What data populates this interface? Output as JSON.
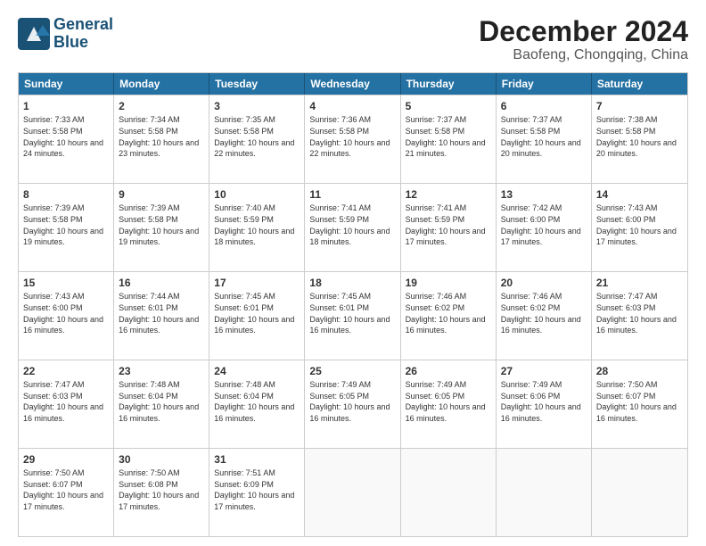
{
  "logo": {
    "line1": "General",
    "line2": "Blue"
  },
  "title": "December 2024",
  "location": "Baofeng, Chongqing, China",
  "header_days": [
    "Sunday",
    "Monday",
    "Tuesday",
    "Wednesday",
    "Thursday",
    "Friday",
    "Saturday"
  ],
  "weeks": [
    [
      {
        "day": "1",
        "sunrise": "Sunrise: 7:33 AM",
        "sunset": "Sunset: 5:58 PM",
        "daylight": "Daylight: 10 hours and 24 minutes."
      },
      {
        "day": "2",
        "sunrise": "Sunrise: 7:34 AM",
        "sunset": "Sunset: 5:58 PM",
        "daylight": "Daylight: 10 hours and 23 minutes."
      },
      {
        "day": "3",
        "sunrise": "Sunrise: 7:35 AM",
        "sunset": "Sunset: 5:58 PM",
        "daylight": "Daylight: 10 hours and 22 minutes."
      },
      {
        "day": "4",
        "sunrise": "Sunrise: 7:36 AM",
        "sunset": "Sunset: 5:58 PM",
        "daylight": "Daylight: 10 hours and 22 minutes."
      },
      {
        "day": "5",
        "sunrise": "Sunrise: 7:37 AM",
        "sunset": "Sunset: 5:58 PM",
        "daylight": "Daylight: 10 hours and 21 minutes."
      },
      {
        "day": "6",
        "sunrise": "Sunrise: 7:37 AM",
        "sunset": "Sunset: 5:58 PM",
        "daylight": "Daylight: 10 hours and 20 minutes."
      },
      {
        "day": "7",
        "sunrise": "Sunrise: 7:38 AM",
        "sunset": "Sunset: 5:58 PM",
        "daylight": "Daylight: 10 hours and 20 minutes."
      }
    ],
    [
      {
        "day": "8",
        "sunrise": "Sunrise: 7:39 AM",
        "sunset": "Sunset: 5:58 PM",
        "daylight": "Daylight: 10 hours and 19 minutes."
      },
      {
        "day": "9",
        "sunrise": "Sunrise: 7:39 AM",
        "sunset": "Sunset: 5:58 PM",
        "daylight": "Daylight: 10 hours and 19 minutes."
      },
      {
        "day": "10",
        "sunrise": "Sunrise: 7:40 AM",
        "sunset": "Sunset: 5:59 PM",
        "daylight": "Daylight: 10 hours and 18 minutes."
      },
      {
        "day": "11",
        "sunrise": "Sunrise: 7:41 AM",
        "sunset": "Sunset: 5:59 PM",
        "daylight": "Daylight: 10 hours and 18 minutes."
      },
      {
        "day": "12",
        "sunrise": "Sunrise: 7:41 AM",
        "sunset": "Sunset: 5:59 PM",
        "daylight": "Daylight: 10 hours and 17 minutes."
      },
      {
        "day": "13",
        "sunrise": "Sunrise: 7:42 AM",
        "sunset": "Sunset: 6:00 PM",
        "daylight": "Daylight: 10 hours and 17 minutes."
      },
      {
        "day": "14",
        "sunrise": "Sunrise: 7:43 AM",
        "sunset": "Sunset: 6:00 PM",
        "daylight": "Daylight: 10 hours and 17 minutes."
      }
    ],
    [
      {
        "day": "15",
        "sunrise": "Sunrise: 7:43 AM",
        "sunset": "Sunset: 6:00 PM",
        "daylight": "Daylight: 10 hours and 16 minutes."
      },
      {
        "day": "16",
        "sunrise": "Sunrise: 7:44 AM",
        "sunset": "Sunset: 6:01 PM",
        "daylight": "Daylight: 10 hours and 16 minutes."
      },
      {
        "day": "17",
        "sunrise": "Sunrise: 7:45 AM",
        "sunset": "Sunset: 6:01 PM",
        "daylight": "Daylight: 10 hours and 16 minutes."
      },
      {
        "day": "18",
        "sunrise": "Sunrise: 7:45 AM",
        "sunset": "Sunset: 6:01 PM",
        "daylight": "Daylight: 10 hours and 16 minutes."
      },
      {
        "day": "19",
        "sunrise": "Sunrise: 7:46 AM",
        "sunset": "Sunset: 6:02 PM",
        "daylight": "Daylight: 10 hours and 16 minutes."
      },
      {
        "day": "20",
        "sunrise": "Sunrise: 7:46 AM",
        "sunset": "Sunset: 6:02 PM",
        "daylight": "Daylight: 10 hours and 16 minutes."
      },
      {
        "day": "21",
        "sunrise": "Sunrise: 7:47 AM",
        "sunset": "Sunset: 6:03 PM",
        "daylight": "Daylight: 10 hours and 16 minutes."
      }
    ],
    [
      {
        "day": "22",
        "sunrise": "Sunrise: 7:47 AM",
        "sunset": "Sunset: 6:03 PM",
        "daylight": "Daylight: 10 hours and 16 minutes."
      },
      {
        "day": "23",
        "sunrise": "Sunrise: 7:48 AM",
        "sunset": "Sunset: 6:04 PM",
        "daylight": "Daylight: 10 hours and 16 minutes."
      },
      {
        "day": "24",
        "sunrise": "Sunrise: 7:48 AM",
        "sunset": "Sunset: 6:04 PM",
        "daylight": "Daylight: 10 hours and 16 minutes."
      },
      {
        "day": "25",
        "sunrise": "Sunrise: 7:49 AM",
        "sunset": "Sunset: 6:05 PM",
        "daylight": "Daylight: 10 hours and 16 minutes."
      },
      {
        "day": "26",
        "sunrise": "Sunrise: 7:49 AM",
        "sunset": "Sunset: 6:05 PM",
        "daylight": "Daylight: 10 hours and 16 minutes."
      },
      {
        "day": "27",
        "sunrise": "Sunrise: 7:49 AM",
        "sunset": "Sunset: 6:06 PM",
        "daylight": "Daylight: 10 hours and 16 minutes."
      },
      {
        "day": "28",
        "sunrise": "Sunrise: 7:50 AM",
        "sunset": "Sunset: 6:07 PM",
        "daylight": "Daylight: 10 hours and 16 minutes."
      }
    ],
    [
      {
        "day": "29",
        "sunrise": "Sunrise: 7:50 AM",
        "sunset": "Sunset: 6:07 PM",
        "daylight": "Daylight: 10 hours and 17 minutes."
      },
      {
        "day": "30",
        "sunrise": "Sunrise: 7:50 AM",
        "sunset": "Sunset: 6:08 PM",
        "daylight": "Daylight: 10 hours and 17 minutes."
      },
      {
        "day": "31",
        "sunrise": "Sunrise: 7:51 AM",
        "sunset": "Sunset: 6:09 PM",
        "daylight": "Daylight: 10 hours and 17 minutes."
      },
      null,
      null,
      null,
      null
    ]
  ]
}
